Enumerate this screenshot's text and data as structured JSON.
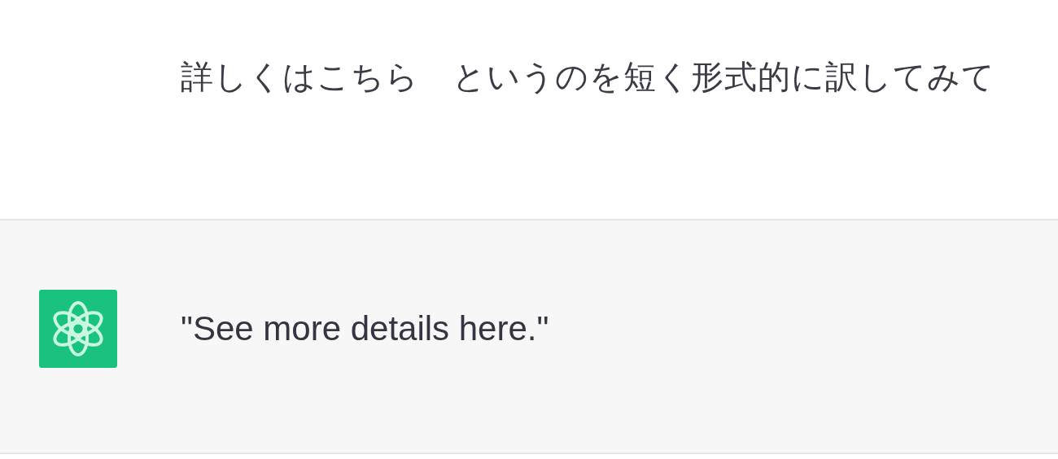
{
  "messages": [
    {
      "kind": "user",
      "text": "詳しくはこちら　というのを短く形式的に訳してみて"
    },
    {
      "kind": "assistant",
      "text": "\"See more details here.\""
    }
  ]
}
